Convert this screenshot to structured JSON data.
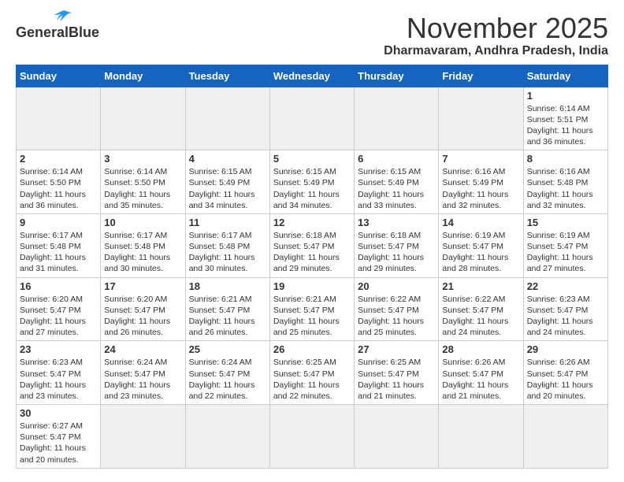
{
  "header": {
    "logo_general": "General",
    "logo_blue": "Blue",
    "month_title": "November 2025",
    "location": "Dharmavaram, Andhra Pradesh, India"
  },
  "weekdays": [
    "Sunday",
    "Monday",
    "Tuesday",
    "Wednesday",
    "Thursday",
    "Friday",
    "Saturday"
  ],
  "weeks": [
    [
      {
        "day": "",
        "info": ""
      },
      {
        "day": "",
        "info": ""
      },
      {
        "day": "",
        "info": ""
      },
      {
        "day": "",
        "info": ""
      },
      {
        "day": "",
        "info": ""
      },
      {
        "day": "",
        "info": ""
      },
      {
        "day": "1",
        "info": "Sunrise: 6:14 AM\nSunset: 5:51 PM\nDaylight: 11 hours\nand 36 minutes."
      }
    ],
    [
      {
        "day": "2",
        "info": "Sunrise: 6:14 AM\nSunset: 5:50 PM\nDaylight: 11 hours\nand 36 minutes."
      },
      {
        "day": "3",
        "info": "Sunrise: 6:14 AM\nSunset: 5:50 PM\nDaylight: 11 hours\nand 35 minutes."
      },
      {
        "day": "4",
        "info": "Sunrise: 6:15 AM\nSunset: 5:49 PM\nDaylight: 11 hours\nand 34 minutes."
      },
      {
        "day": "5",
        "info": "Sunrise: 6:15 AM\nSunset: 5:49 PM\nDaylight: 11 hours\nand 34 minutes."
      },
      {
        "day": "6",
        "info": "Sunrise: 6:15 AM\nSunset: 5:49 PM\nDaylight: 11 hours\nand 33 minutes."
      },
      {
        "day": "7",
        "info": "Sunrise: 6:16 AM\nSunset: 5:49 PM\nDaylight: 11 hours\nand 32 minutes."
      },
      {
        "day": "8",
        "info": "Sunrise: 6:16 AM\nSunset: 5:48 PM\nDaylight: 11 hours\nand 32 minutes."
      }
    ],
    [
      {
        "day": "9",
        "info": "Sunrise: 6:17 AM\nSunset: 5:48 PM\nDaylight: 11 hours\nand 31 minutes."
      },
      {
        "day": "10",
        "info": "Sunrise: 6:17 AM\nSunset: 5:48 PM\nDaylight: 11 hours\nand 30 minutes."
      },
      {
        "day": "11",
        "info": "Sunrise: 6:17 AM\nSunset: 5:48 PM\nDaylight: 11 hours\nand 30 minutes."
      },
      {
        "day": "12",
        "info": "Sunrise: 6:18 AM\nSunset: 5:47 PM\nDaylight: 11 hours\nand 29 minutes."
      },
      {
        "day": "13",
        "info": "Sunrise: 6:18 AM\nSunset: 5:47 PM\nDaylight: 11 hours\nand 29 minutes."
      },
      {
        "day": "14",
        "info": "Sunrise: 6:19 AM\nSunset: 5:47 PM\nDaylight: 11 hours\nand 28 minutes."
      },
      {
        "day": "15",
        "info": "Sunrise: 6:19 AM\nSunset: 5:47 PM\nDaylight: 11 hours\nand 27 minutes."
      }
    ],
    [
      {
        "day": "16",
        "info": "Sunrise: 6:20 AM\nSunset: 5:47 PM\nDaylight: 11 hours\nand 27 minutes."
      },
      {
        "day": "17",
        "info": "Sunrise: 6:20 AM\nSunset: 5:47 PM\nDaylight: 11 hours\nand 26 minutes."
      },
      {
        "day": "18",
        "info": "Sunrise: 6:21 AM\nSunset: 5:47 PM\nDaylight: 11 hours\nand 26 minutes."
      },
      {
        "day": "19",
        "info": "Sunrise: 6:21 AM\nSunset: 5:47 PM\nDaylight: 11 hours\nand 25 minutes."
      },
      {
        "day": "20",
        "info": "Sunrise: 6:22 AM\nSunset: 5:47 PM\nDaylight: 11 hours\nand 25 minutes."
      },
      {
        "day": "21",
        "info": "Sunrise: 6:22 AM\nSunset: 5:47 PM\nDaylight: 11 hours\nand 24 minutes."
      },
      {
        "day": "22",
        "info": "Sunrise: 6:23 AM\nSunset: 5:47 PM\nDaylight: 11 hours\nand 24 minutes."
      }
    ],
    [
      {
        "day": "23",
        "info": "Sunrise: 6:23 AM\nSunset: 5:47 PM\nDaylight: 11 hours\nand 23 minutes."
      },
      {
        "day": "24",
        "info": "Sunrise: 6:24 AM\nSunset: 5:47 PM\nDaylight: 11 hours\nand 23 minutes."
      },
      {
        "day": "25",
        "info": "Sunrise: 6:24 AM\nSunset: 5:47 PM\nDaylight: 11 hours\nand 22 minutes."
      },
      {
        "day": "26",
        "info": "Sunrise: 6:25 AM\nSunset: 5:47 PM\nDaylight: 11 hours\nand 22 minutes."
      },
      {
        "day": "27",
        "info": "Sunrise: 6:25 AM\nSunset: 5:47 PM\nDaylight: 11 hours\nand 21 minutes."
      },
      {
        "day": "28",
        "info": "Sunrise: 6:26 AM\nSunset: 5:47 PM\nDaylight: 11 hours\nand 21 minutes."
      },
      {
        "day": "29",
        "info": "Sunrise: 6:26 AM\nSunset: 5:47 PM\nDaylight: 11 hours\nand 20 minutes."
      }
    ],
    [
      {
        "day": "30",
        "info": "Sunrise: 6:27 AM\nSunset: 5:47 PM\nDaylight: 11 hours\nand 20 minutes."
      },
      {
        "day": "",
        "info": ""
      },
      {
        "day": "",
        "info": ""
      },
      {
        "day": "",
        "info": ""
      },
      {
        "day": "",
        "info": ""
      },
      {
        "day": "",
        "info": ""
      },
      {
        "day": "",
        "info": ""
      }
    ]
  ]
}
